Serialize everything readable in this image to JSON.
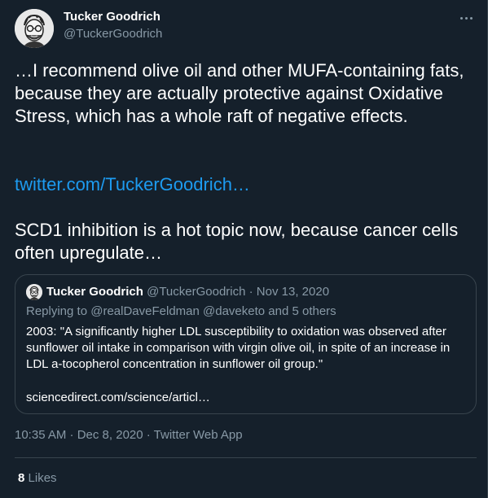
{
  "tweet": {
    "author_name": "Tucker Goodrich",
    "author_handle": "@TuckerGoodrich",
    "more_icon": "more-horizontal-icon",
    "text_paragraph_1": "…I recommend olive oil and other MUFA-containing fats, because they are actually protective against Oxidative Stress, which has a whole raft of negative effects.",
    "link_text": "twitter.com/TuckerGoodrich…",
    "text_paragraph_2": "SCD1 inhibition is a hot topic now, because cancer cells often upregulate…",
    "timestamp": "10:35 AM · Dec 8, 2020 · ",
    "source_app": "Twitter Web App",
    "likes_count": "8",
    "likes_label": "Likes"
  },
  "quoted_tweet": {
    "author_name": "Tucker Goodrich",
    "meta": "@TuckerGoodrich · Nov 13, 2020",
    "replying_to_prefix": "Replying to ",
    "replying_to_mentions": "@realDaveFeldman @daveketo",
    "replying_to_suffix": " and 5 others",
    "text": "2003: \"A significantly higher LDL susceptibility to oxidation was observed after sunflower oil intake in comparison with virgin olive oil, in spite of an increase in LDL a-tocopherol concentration in sunflower oil group.\"",
    "link_text": "sciencedirect.com/science/articl…"
  },
  "colors": {
    "background": "#15202b",
    "text_primary": "#ffffff",
    "text_secondary": "#8899a6",
    "link": "#1d9bf0",
    "border": "#38444d"
  }
}
